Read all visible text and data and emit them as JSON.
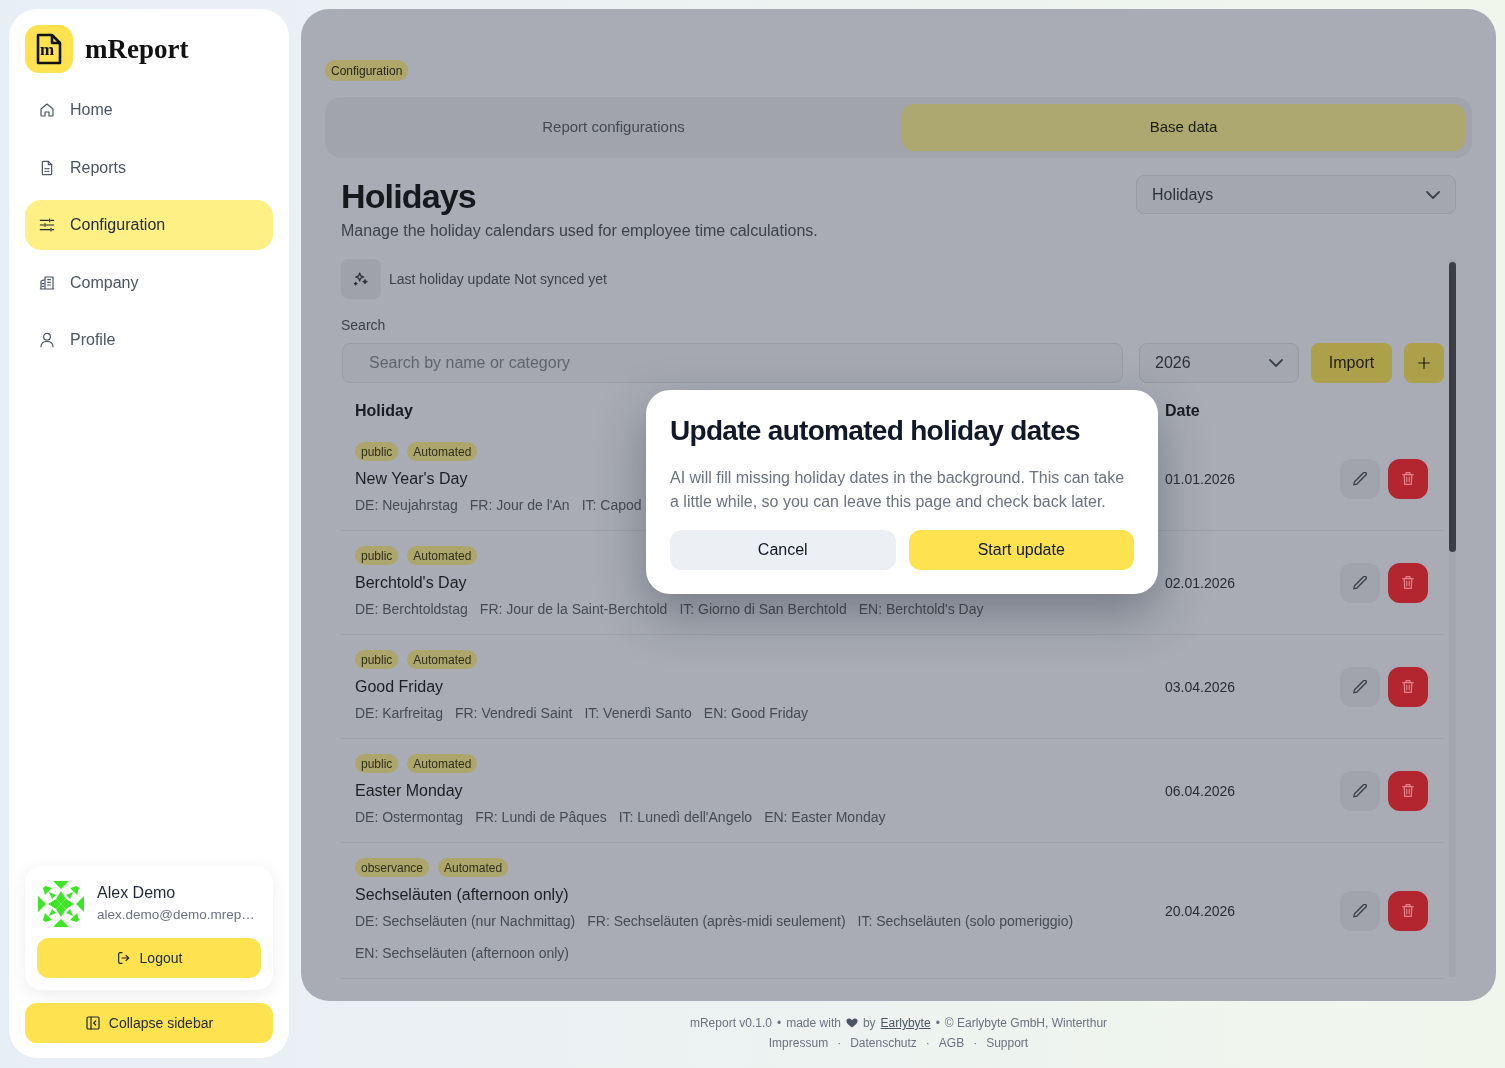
{
  "sidebar": {
    "brand": {
      "mark": "m",
      "name": "mReport"
    },
    "items": [
      {
        "label": "Home",
        "selected": false
      },
      {
        "label": "Reports",
        "selected": false
      },
      {
        "label": "Configuration",
        "selected": true
      },
      {
        "label": "Company",
        "selected": false
      },
      {
        "label": "Profile",
        "selected": false
      }
    ],
    "user": {
      "name": "Alex Demo",
      "email": "alex.demo@demo.mrep…"
    },
    "logout_button": "Logout",
    "collapse_button": "Collapse sidebar"
  },
  "breadcrumb": "Configuration",
  "tabs": [
    {
      "label": "Report configurations",
      "selected": false
    },
    {
      "label": "Base data",
      "selected": true
    }
  ],
  "page": {
    "title": "Holidays",
    "subtitle": "Manage the holiday calendars used for employee time calculations.",
    "view_select": "Holidays",
    "sync_status": "Last holiday update Not synced yet",
    "search": {
      "label": "Search",
      "placeholder": "Search by name or category"
    },
    "year_select": "2026",
    "import_button": "Import"
  },
  "table": {
    "columns": [
      "Holiday",
      "Date"
    ],
    "rows": [
      {
        "tags": [
          "public",
          "Automated"
        ],
        "name": "New Year's Day",
        "translations": [
          "DE: Neujahrstag",
          "FR: Jour de l'An",
          "IT: Capod"
        ],
        "date": "01.01.2026"
      },
      {
        "tags": [
          "public",
          "Automated"
        ],
        "name": "Berchtold's Day",
        "translations": [
          "DE: Berchtoldstag",
          "FR: Jour de la Saint-Berchtold",
          "IT: Giorno di San Berchtold",
          "EN: Berchtold's Day"
        ],
        "date": "02.01.2026"
      },
      {
        "tags": [
          "public",
          "Automated"
        ],
        "name": "Good Friday",
        "translations": [
          "DE: Karfreitag",
          "FR: Vendredi Saint",
          "IT: Venerdì Santo",
          "EN: Good Friday"
        ],
        "date": "03.04.2026"
      },
      {
        "tags": [
          "public",
          "Automated"
        ],
        "name": "Easter Monday",
        "translations": [
          "DE: Ostermontag",
          "FR: Lundi de Pâques",
          "IT: Lunedì dell'Angelo",
          "EN: Easter Monday"
        ],
        "date": "06.04.2026"
      },
      {
        "tags": [
          "observance",
          "Automated"
        ],
        "name": "Sechseläuten (afternoon only)",
        "translations": [
          "DE: Sechseläuten (nur Nachmittag)",
          "FR: Sechseläuten (après-midi seulement)",
          "IT: Sechseläuten (solo pomeriggio)",
          "EN: Sechseläuten (afternoon only)"
        ],
        "date": "20.04.2026"
      }
    ]
  },
  "dialog": {
    "title": "Update automated holiday dates",
    "message": "AI will fill missing holiday dates in the background. This can take a little while, so you can leave this page and check back later.",
    "buttons": [
      {
        "label": "Cancel",
        "kind": "secondary"
      },
      {
        "label": "Start update",
        "kind": "primary"
      }
    ]
  },
  "footer": {
    "lines": [
      {
        "parts": [
          {
            "kind": "text",
            "text": "mReport v0.1.0"
          },
          {
            "kind": "separator",
            "text": "•"
          },
          {
            "kind": "text",
            "text": "made with"
          },
          {
            "kind": "icon"
          },
          {
            "kind": "text",
            "text": "by"
          },
          {
            "kind": "link",
            "text": "Earlybyte"
          },
          {
            "kind": "separator",
            "text": "•"
          },
          {
            "kind": "text",
            "text": "© Earlybyte GmbH, Winterthur"
          }
        ]
      },
      {
        "parts": [
          {
            "kind": "link",
            "text": "Impressum"
          },
          {
            "kind": "separator",
            "text": "·"
          },
          {
            "kind": "link",
            "text": "Datenschutz"
          },
          {
            "kind": "separator",
            "text": "·"
          },
          {
            "kind": "link",
            "text": "AGB"
          },
          {
            "kind": "separator",
            "text": "·"
          },
          {
            "kind": "link",
            "text": "Support"
          }
        ]
      }
    ]
  }
}
